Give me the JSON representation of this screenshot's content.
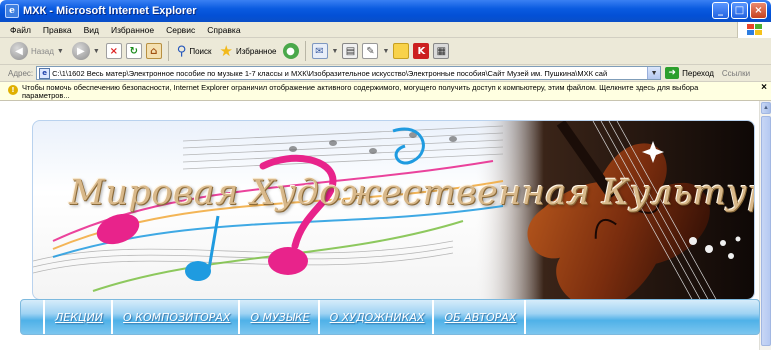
{
  "window": {
    "title": "МХК - Microsoft Internet Explorer",
    "controls": [
      "_",
      "□",
      "×"
    ]
  },
  "menubar": {
    "items": [
      "Файл",
      "Правка",
      "Вид",
      "Избранное",
      "Сервис",
      "Справка"
    ]
  },
  "toolbar": {
    "back_label": "Назад",
    "search_label": "Поиск",
    "favorites_label": "Избранное"
  },
  "addressbar": {
    "label": "Адрес:",
    "url": "C:\\1\\1602 Весь матер\\Электронное пособие по музыке 1-7 классы и МХК\\Изобразительное искусство\\Электронные пособия\\Сайт Музей им. Пушкина\\МХК сай",
    "go_label": "Переход",
    "links_label": "Ссылки"
  },
  "infobar": {
    "text": "Чтобы помочь обеспечению безопасности, Internet Explorer ограничил отображение активного содержимого, могущего получить доступ к компьютеру, этим файлом. Щелкните здесь для выбора параметров..."
  },
  "banner": {
    "title": "Мировая Художественная Культура"
  },
  "nav": {
    "items": [
      "ЛЕКЦИИ",
      "О КОМПОЗИТОРАХ",
      "О МУЗЫКЕ",
      "О ХУДОЖНИКАХ",
      "ОБ АВТОРАХ"
    ]
  },
  "colors": {
    "titlebar": "#0a5be0",
    "chrome": "#ece9d8",
    "infobar": "#ffffe1",
    "nav_blue": "#4fb1e8",
    "note_pink": "#e8238b",
    "note_blue": "#1f9be0",
    "violin": "#7a2d0e"
  }
}
